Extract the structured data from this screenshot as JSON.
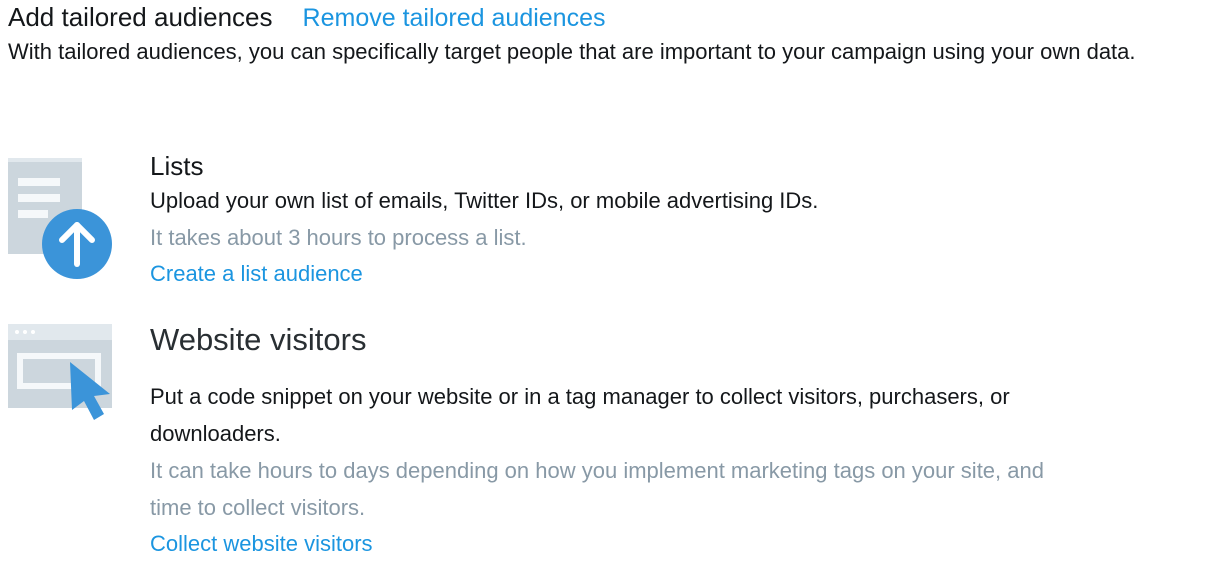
{
  "header": {
    "title": "Add tailored audiences",
    "remove_link": "Remove tailored audiences",
    "intro": "With tailored audiences, you can specifically target people that are important to your campaign using your own data."
  },
  "colors": {
    "link": "#1b95e0",
    "muted": "#8899a6",
    "text": "#14171a",
    "icon_gray": "#ccd6dd",
    "icon_blue": "#3b94d9"
  },
  "sections": [
    {
      "icon": "upload-list-icon",
      "title": "Lists",
      "description": "Upload your own list of emails, Twitter IDs, or mobile advertising IDs.",
      "note": "It takes about 3 hours to process a list.",
      "action": "Create a list audience"
    },
    {
      "icon": "website-cursor-icon",
      "title": "Website visitors",
      "description": "Put a code snippet on your website or in a tag manager to collect visitors, purchasers, or downloaders.",
      "note": "It can take hours to days depending on how you implement marketing tags on your site, and time to collect visitors.",
      "action": "Collect website visitors"
    }
  ]
}
